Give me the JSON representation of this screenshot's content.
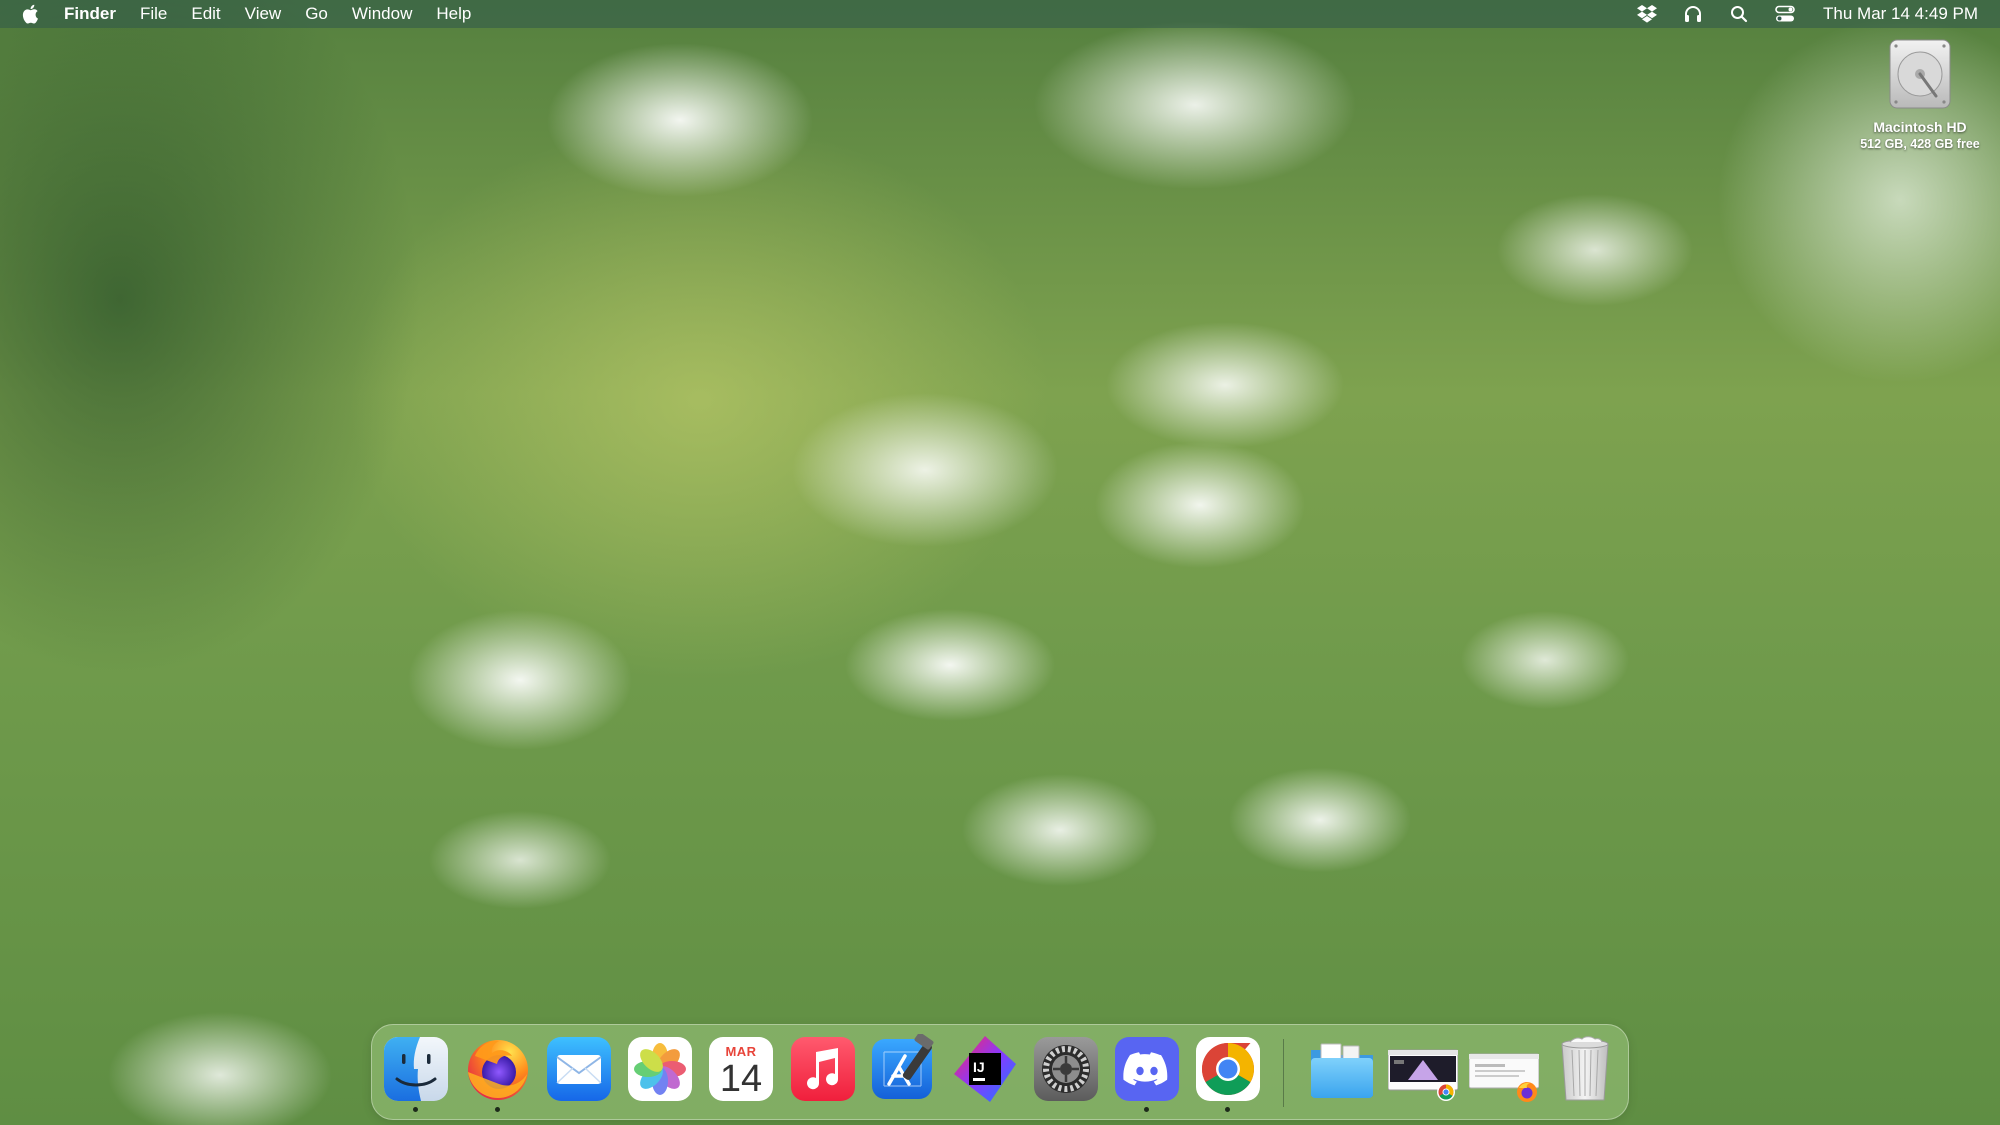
{
  "menubar": {
    "app_name": "Finder",
    "menus": [
      "File",
      "Edit",
      "View",
      "Go",
      "Window",
      "Help"
    ],
    "status_icons": [
      "dropbox-icon",
      "headphones-icon",
      "spotlight-search-icon",
      "control-center-icon"
    ],
    "clock": "Thu Mar 14  4:49 PM"
  },
  "desktop": {
    "disk": {
      "name": "Macintosh HD",
      "info": "512 GB, 428 GB free",
      "icon": "hard-drive-icon"
    }
  },
  "dock": {
    "apps": [
      {
        "name": "Finder",
        "icon": "finder-icon",
        "running": true
      },
      {
        "name": "Firefox",
        "icon": "firefox-icon",
        "running": true
      },
      {
        "name": "Mail",
        "icon": "mail-icon",
        "running": false
      },
      {
        "name": "Photos",
        "icon": "photos-icon",
        "running": false
      },
      {
        "name": "Calendar",
        "icon": "calendar-icon",
        "running": false
      },
      {
        "name": "Music",
        "icon": "music-icon",
        "running": false
      },
      {
        "name": "Xcode",
        "icon": "xcode-icon",
        "running": false
      },
      {
        "name": "IntelliJ IDEA",
        "icon": "intellij-icon",
        "running": false
      },
      {
        "name": "System Settings",
        "icon": "system-settings-icon",
        "running": false
      },
      {
        "name": "Discord",
        "icon": "discord-icon",
        "running": true
      },
      {
        "name": "Google Chrome",
        "icon": "chrome-icon",
        "running": true
      }
    ],
    "calendar": {
      "month": "MAR",
      "day": "14"
    },
    "ij_label": "IJ",
    "stacks": [
      {
        "name": "Downloads",
        "icon": "folder-icon"
      },
      {
        "name": "Chrome window",
        "icon": "chrome-window-thumbnail-icon"
      },
      {
        "name": "Firefox window",
        "icon": "firefox-window-thumbnail-icon"
      },
      {
        "name": "Trash",
        "icon": "trash-icon"
      }
    ]
  },
  "colors": {
    "menubar_bg": "#30584a",
    "dock_bg": "#aad28c",
    "calendar_red": "#e8443a"
  }
}
